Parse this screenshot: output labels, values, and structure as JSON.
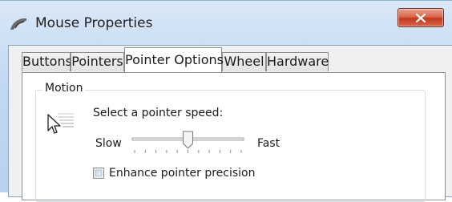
{
  "window": {
    "title": "Mouse Properties",
    "app_icon": "mouse-icon",
    "close_icon": "close-icon"
  },
  "tabs": [
    {
      "label": "Buttons",
      "active": false
    },
    {
      "label": "Pointers",
      "active": false
    },
    {
      "label": "Pointer Options",
      "active": true
    },
    {
      "label": "Wheel",
      "active": false
    },
    {
      "label": "Hardware",
      "active": false
    }
  ],
  "motion": {
    "group_label": "Motion",
    "icon": "pointer-speed-icon",
    "speed_prompt": "Select a pointer speed:",
    "slow_label": "Slow",
    "fast_label": "Fast",
    "speed_value": 0.5,
    "tick_count": 11,
    "enhance_label": "Enhance pointer precision",
    "enhance_checked": false
  },
  "colors": {
    "close_button": "#c2391f",
    "title_bar": "#c4d9f1"
  }
}
